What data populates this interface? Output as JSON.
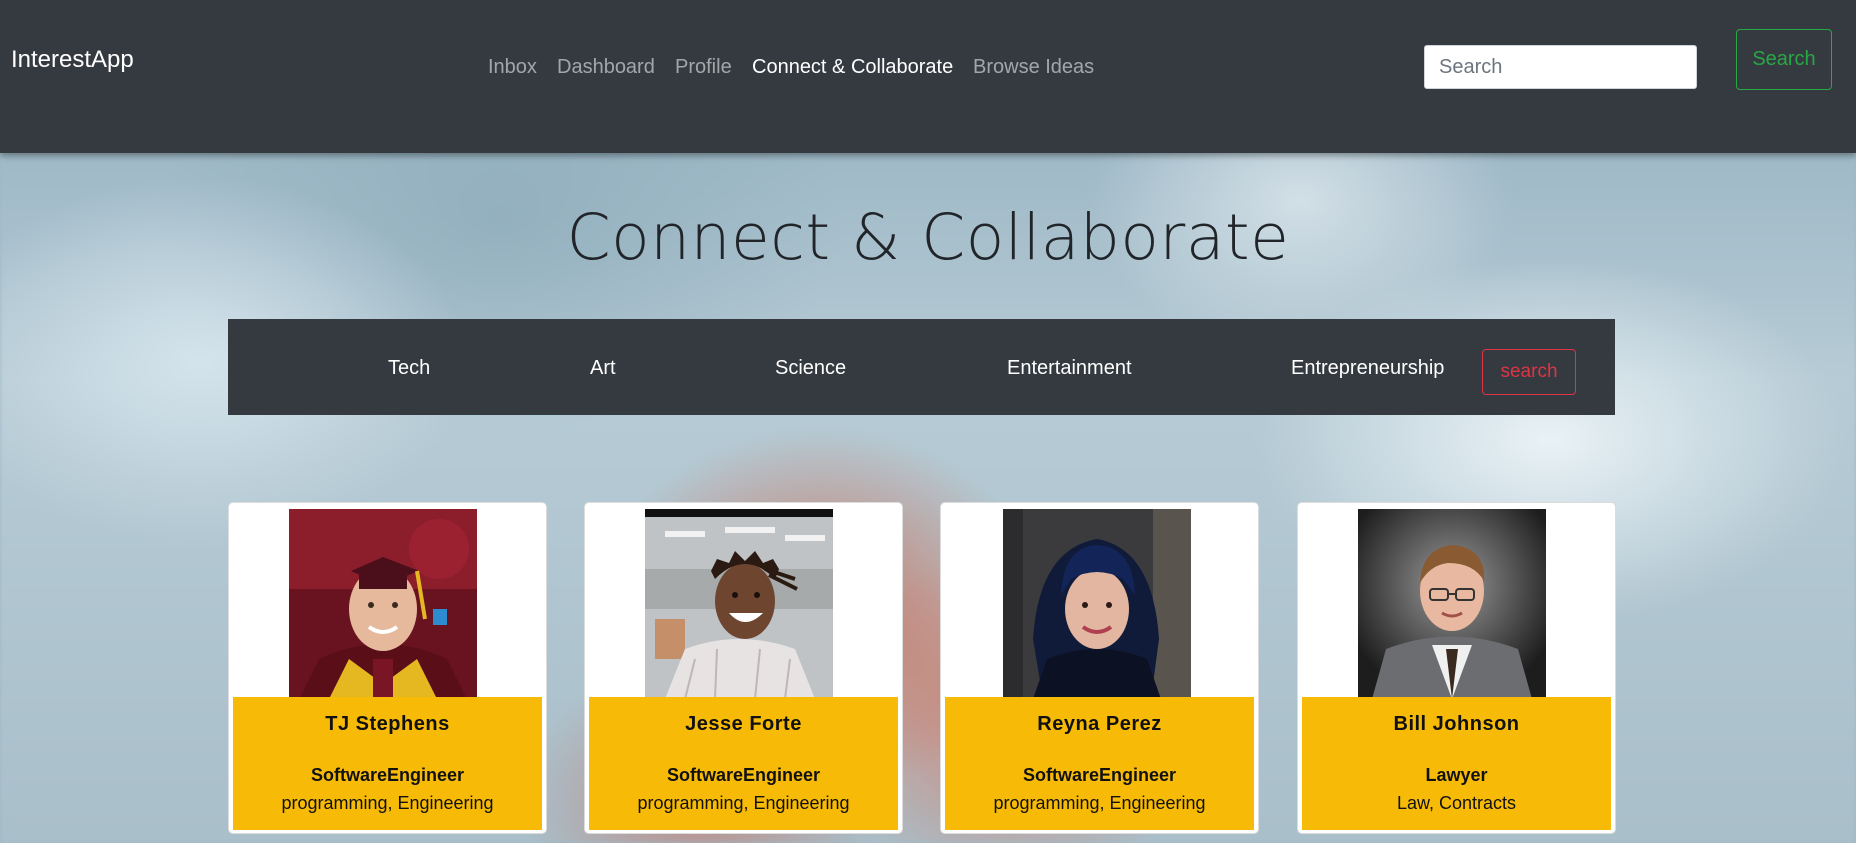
{
  "app": {
    "brand": "InterestApp"
  },
  "nav": {
    "links": [
      {
        "label": "Inbox",
        "active": false
      },
      {
        "label": "Dashboard",
        "active": false
      },
      {
        "label": "Profile",
        "active": false
      },
      {
        "label": "Connect & Collaborate",
        "active": true
      },
      {
        "label": "Browse Ideas",
        "active": false
      }
    ],
    "search_placeholder": "Search",
    "search_value": "",
    "search_button": "Search"
  },
  "page": {
    "title": "Connect & Collaborate"
  },
  "categories": {
    "items": [
      "Tech",
      "Art",
      "Science",
      "Entertainment",
      "Entrepreneurship"
    ],
    "search_button": "search"
  },
  "people": [
    {
      "name": "TJ Stephens",
      "role": "SoftwareEngineer",
      "tags": "programming, Engineering",
      "photo_icon": "graduate-portrait"
    },
    {
      "name": "Jesse Forte",
      "role": "SoftwareEngineer",
      "tags": "programming, Engineering",
      "photo_icon": "smiling-portrait"
    },
    {
      "name": "Reyna Perez",
      "role": "SoftwareEngineer",
      "tags": "programming, Engineering",
      "photo_icon": "portrait"
    },
    {
      "name": "Bill Johnson",
      "role": "Lawyer",
      "tags": "Law, Contracts",
      "photo_icon": "suit-portrait"
    }
  ],
  "colors": {
    "navbar": "#343a40",
    "accent_green": "#28a745",
    "accent_red": "#dc3545",
    "card_body": "#f7bb07"
  }
}
